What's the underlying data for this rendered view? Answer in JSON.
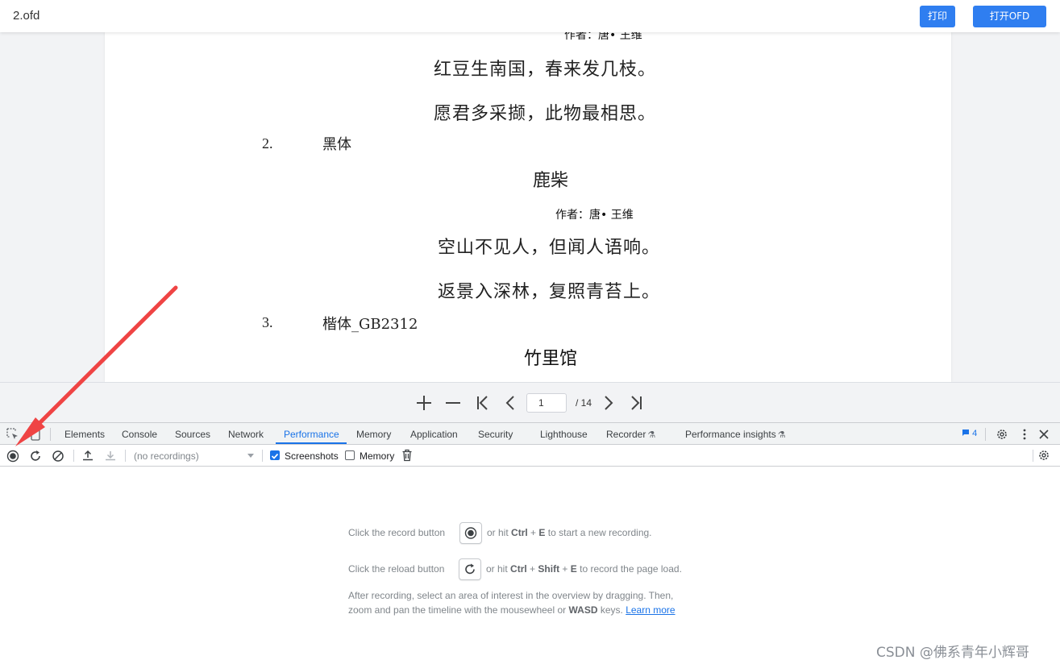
{
  "app": {
    "file_name": "2.ofd",
    "print_button": "打印",
    "open_button": "打开OFD"
  },
  "document": {
    "top_author_cut": "作者：唐• 王维",
    "poem1_line1": "红豆生南国，春来发几枝。",
    "poem1_line2": "愿君多采撷，此物最相思。",
    "item2_number": "2.",
    "item2_label": "黑体",
    "poem2_title": "鹿柴",
    "poem2_author": "作者：唐• 王维",
    "poem2_line1": "空山不见人，但闻人语响。",
    "poem2_line2": "返景入深林，复照青苔上。",
    "item3_number": "3.",
    "item3_label": "楷体_GB2312",
    "poem3_title": "竹里馆"
  },
  "pager": {
    "current_page": "1",
    "total_pages": "/ 14"
  },
  "devtools": {
    "tabs": [
      "Elements",
      "Console",
      "Sources",
      "Network",
      "Performance",
      "Memory",
      "Application",
      "Security",
      "Lighthouse",
      "Recorder",
      "Performance insights"
    ],
    "active_tab": "Performance",
    "message_count": "4",
    "toolbar": {
      "recordings_placeholder": "(no recordings)",
      "screenshots_label": "Screenshots",
      "screenshots_checked": true,
      "memory_label": "Memory",
      "memory_checked": false
    },
    "landing": {
      "record_prefix": "Click the record button",
      "record_mid": "or hit",
      "record_key1": "Ctrl",
      "plus": "+",
      "record_key2": "E",
      "record_suffix": "to start a new recording.",
      "reload_prefix": "Click the reload button",
      "reload_mid": "or hit",
      "reload_key1": "Ctrl",
      "reload_key2": "Shift",
      "reload_key3": "E",
      "reload_suffix": "to record the page load.",
      "after_line1": "After recording, select an area of interest in the overview by dragging. Then,",
      "after_line2_prefix": "zoom and pan the timeline with the mousewheel or",
      "after_keys": "WASD",
      "after_line2_suffix": "keys.",
      "learn_more": "Learn more"
    }
  },
  "watermark": "CSDN @佛系青年小辉哥",
  "colors": {
    "accent_blue": "#2f7ef0",
    "devtools_blue": "#1a73e8",
    "annotation_red": "#ef4444"
  },
  "icons": [
    "plus-icon",
    "minus-icon",
    "first-page-icon",
    "prev-page-icon",
    "next-page-icon",
    "last-page-icon",
    "inspect-icon",
    "device-toolbar-icon",
    "flask-icon",
    "message-icon",
    "gear-icon",
    "more-vert-icon",
    "close-icon",
    "record-icon",
    "reload-icon",
    "clear-icon",
    "upload-icon",
    "download-icon",
    "trash-icon",
    "arrow-annotation"
  ]
}
